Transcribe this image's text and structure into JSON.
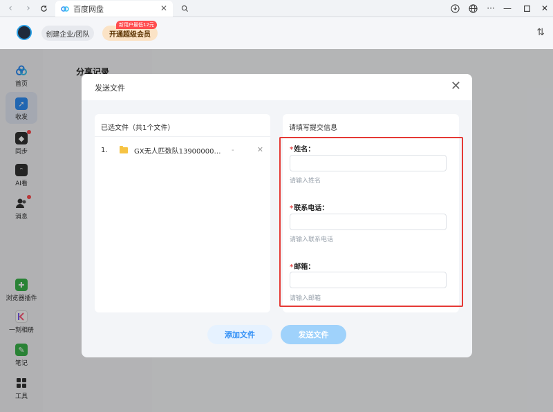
{
  "browser": {
    "tab_title": "百度网盘"
  },
  "appbar": {
    "team_label": "创建企业/团队",
    "vip_label": "开通超级会员",
    "promo_badge": "新用户最低12元"
  },
  "sidebar": {
    "items": [
      {
        "label": "首页",
        "icon": "cloud-home-icon",
        "color": "#2f8ef5"
      },
      {
        "label": "收发",
        "icon": "share-icon",
        "color": "#2f8ef5",
        "active": true
      },
      {
        "label": "同步",
        "icon": "sync-icon",
        "color": "#333333",
        "dot": true
      },
      {
        "label": "AI看",
        "icon": "ai-view-icon",
        "color": "#333333"
      },
      {
        "label": "消息",
        "icon": "message-icon",
        "color": "#333333",
        "dot": true
      },
      {
        "label": "浏览器插件",
        "icon": "plugin-icon",
        "color": "#39b54a"
      },
      {
        "label": "一刻相册",
        "icon": "album-icon",
        "color": "#7b5cf0"
      },
      {
        "label": "笔记",
        "icon": "note-icon",
        "color": "#39b54a"
      },
      {
        "label": "工具",
        "icon": "tools-icon",
        "color": "#333333"
      }
    ]
  },
  "subpanel": {
    "title": "分享记录"
  },
  "modal": {
    "title": "发送文件",
    "files_header": "已选文件（共1个文件）",
    "files": [
      {
        "index": "1.",
        "name": "GX无人匹数队1390000000...",
        "size": "-"
      }
    ],
    "info_header": "请填写提交信息",
    "fields": [
      {
        "label": "姓名：",
        "required": "*",
        "value": "",
        "hint": "请输入姓名"
      },
      {
        "label": "联系电话：",
        "required": "*",
        "value": "",
        "hint": "请输入联系电话"
      },
      {
        "label": "邮箱：",
        "required": "*",
        "value": "",
        "hint": "请输入邮箱"
      }
    ],
    "add_button": "添加文件",
    "send_button": "发送文件"
  }
}
